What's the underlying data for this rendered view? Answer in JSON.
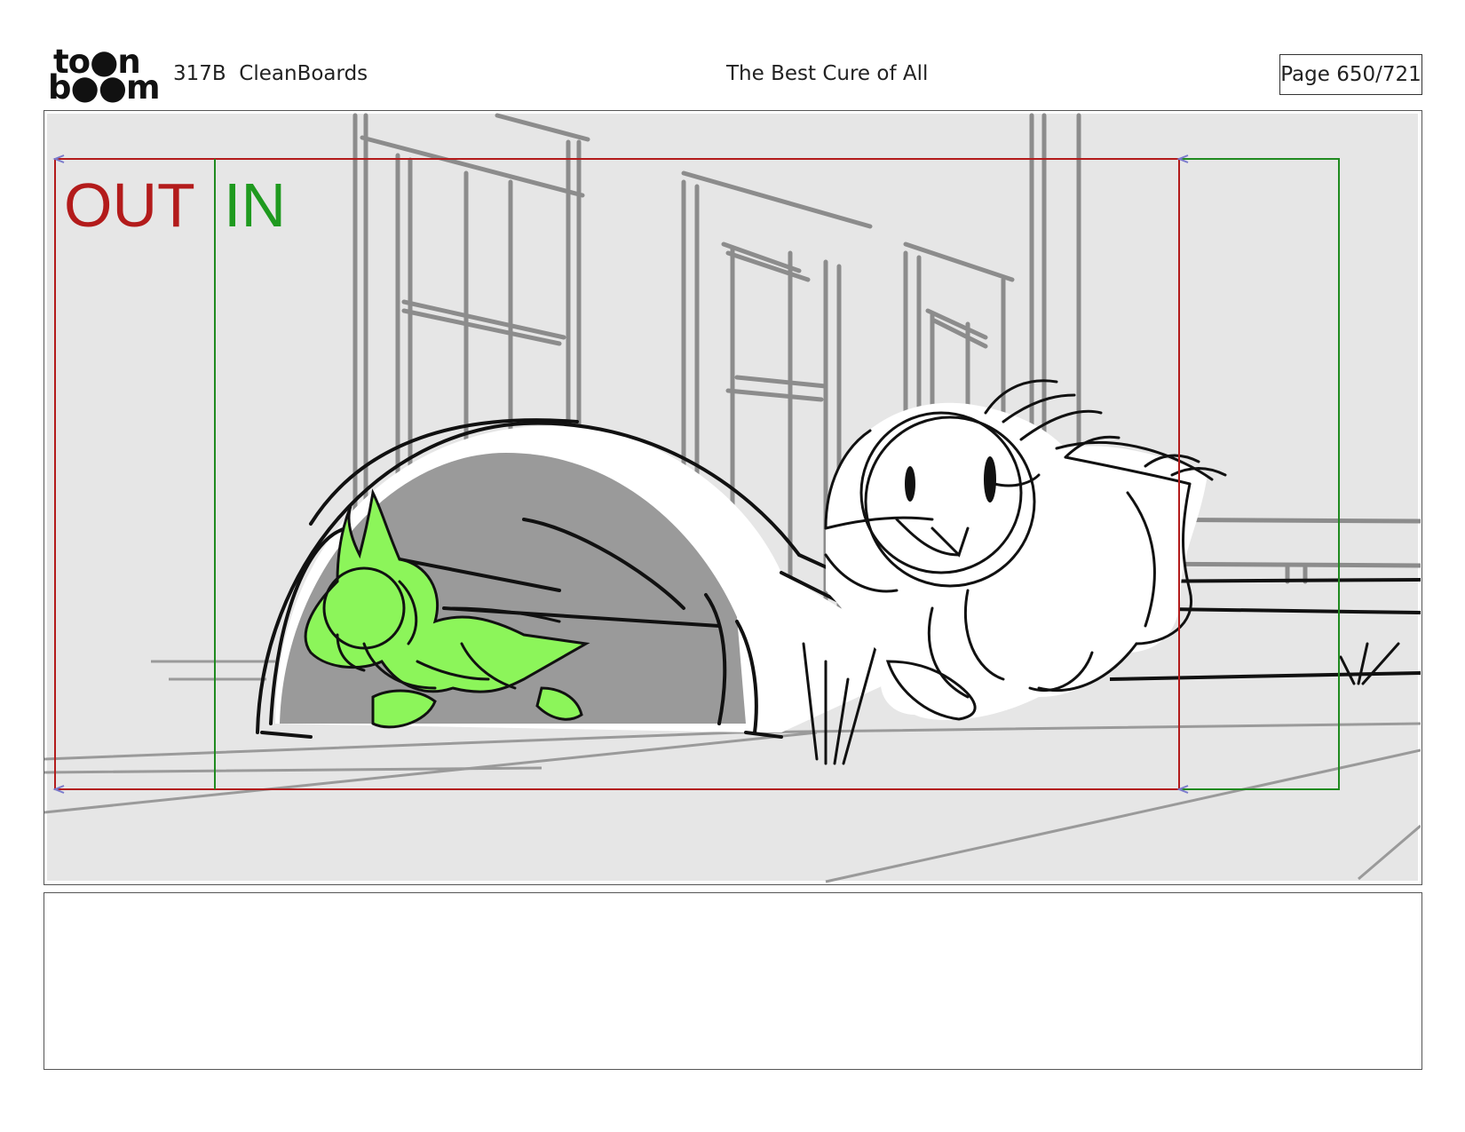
{
  "header": {
    "logo_line1": "to●n",
    "logo_line2": "b●●m",
    "episode": "317B  CleanBoards",
    "title": "The Best Cure of All",
    "page": "Page 650/721"
  },
  "panel": {
    "out_label": "OUT",
    "in_label": "IN",
    "colors": {
      "out_frame": "#b31b1b",
      "in_frame": "#1f8a1f",
      "background": "#e6e6e6",
      "character_green": "#8cf55a"
    }
  },
  "notes": {
    "text": ""
  }
}
